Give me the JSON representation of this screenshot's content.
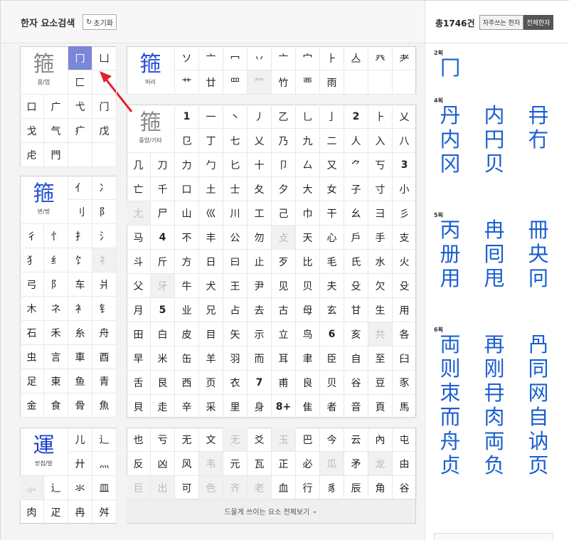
{
  "header": {
    "title": "한자 요소검색",
    "reset_label": "초기화",
    "reset_icon": "refresh-icon",
    "total": "총1746건",
    "seg_frequent": "자주쓰는 한자",
    "seg_all": "전체한자"
  },
  "panels": {
    "outer": {
      "caption": "몸/엄",
      "glyph": "箍"
    },
    "head": {
      "caption": "머리",
      "glyph": "箍"
    },
    "side": {
      "caption": "변/방",
      "glyph": "箍"
    },
    "middle": {
      "caption": "중앙/기타",
      "glyph": "箍"
    },
    "bottom": {
      "caption": "받침/발",
      "glyph": "運"
    }
  },
  "selected_component": "冂",
  "more_label": "드물게 쓰이는 요소 전체보기",
  "strokes": [
    {
      "label": "2획",
      "chars": [
        "冂"
      ]
    },
    {
      "label": "4획",
      "chars": [
        "丹",
        "内",
        "冄",
        "内",
        "円",
        "冇",
        "冈",
        "贝"
      ]
    },
    {
      "label": "5획",
      "chars": [
        "丙",
        "冉",
        "冊",
        "册",
        "囘",
        "央",
        "用",
        "甩",
        "冋"
      ]
    },
    {
      "label": "6획",
      "chars": [
        "両",
        "再",
        "冎",
        "则",
        "刚",
        "同",
        "朿",
        "冄",
        "网",
        "而",
        "肉",
        "自",
        "舟",
        "両",
        "讷",
        "贞",
        "负",
        "页"
      ]
    }
  ]
}
